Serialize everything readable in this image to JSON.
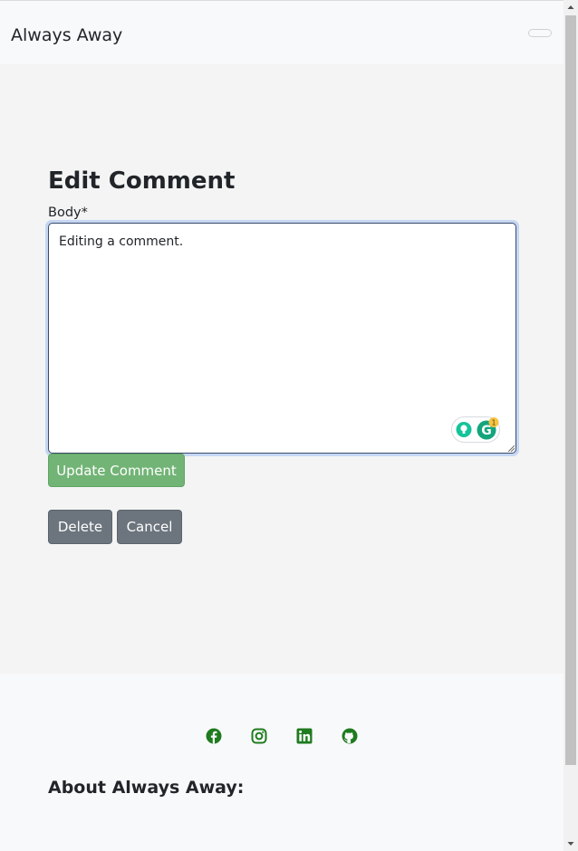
{
  "navbar": {
    "brand": "Always Away"
  },
  "form": {
    "title": "Edit Comment",
    "body_label": "Body*",
    "body_value": "Editing a comment.",
    "update_label": "Update Comment",
    "delete_label": "Delete",
    "cancel_label": "Cancel"
  },
  "grammarly": {
    "badge_count": "1"
  },
  "footer": {
    "social_icons": [
      "facebook-icon",
      "instagram-icon",
      "linkedin-icon",
      "github-icon"
    ],
    "about_heading": "About Always Away:"
  },
  "colors": {
    "accent_green": "#1e7b1e",
    "update_button": "#72b476",
    "secondary_button": "#6c757d",
    "navbar_bg": "#f8f9fa",
    "page_bg": "#f4f4f4"
  }
}
